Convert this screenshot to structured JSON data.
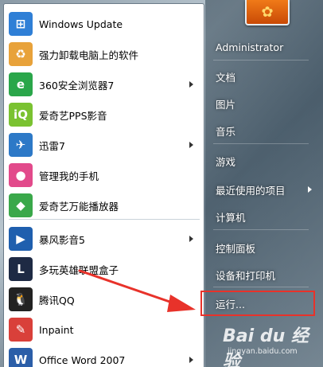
{
  "programs": [
    {
      "label": "Windows Update",
      "icon": "windows-update-icon",
      "color": "#2f7fd6",
      "glyph": "⊞",
      "has_submenu": false
    },
    {
      "label": "强力卸载电脑上的软件",
      "icon": "uninstall-icon",
      "color": "#e8a23a",
      "glyph": "♻",
      "has_submenu": false
    },
    {
      "label": "360安全浏览器7",
      "icon": "browser-360-icon",
      "color": "#2aa64a",
      "glyph": "e",
      "has_submenu": true
    },
    {
      "label": "爱奇艺PPS影音",
      "icon": "iqiyi-pps-icon",
      "color": "#7ac231",
      "glyph": "iQ",
      "has_submenu": false
    },
    {
      "label": "迅雷7",
      "icon": "xunlei-icon",
      "color": "#2d79c7",
      "glyph": "✈",
      "has_submenu": true
    },
    {
      "label": "管理我的手机",
      "icon": "phone-manager-icon",
      "color": "#e24a8b",
      "glyph": "●",
      "has_submenu": false
    },
    {
      "label": "爱奇艺万能播放器",
      "icon": "iqiyi-player-icon",
      "color": "#3aa84a",
      "glyph": "◆",
      "has_submenu": false
    },
    {
      "label": "暴风影音5",
      "icon": "baofeng-icon",
      "color": "#1f5fae",
      "glyph": "▶",
      "has_submenu": true
    },
    {
      "label": "多玩英雄联盟盒子",
      "icon": "lol-box-icon",
      "color": "#1e2a44",
      "glyph": "L",
      "has_submenu": false
    },
    {
      "label": "腾讯QQ",
      "icon": "qq-penguin-icon",
      "color": "#222222",
      "glyph": "🐧",
      "has_submenu": false
    },
    {
      "label": "Inpaint",
      "icon": "inpaint-icon",
      "color": "#d9403a",
      "glyph": "✎",
      "has_submenu": false
    },
    {
      "label": "Office Word 2007",
      "icon": "word-icon",
      "color": "#2b5ea8",
      "glyph": "W",
      "has_submenu": true
    }
  ],
  "right_items": [
    {
      "label": "Administrator",
      "name": "administrator",
      "has_submenu": false
    },
    {
      "label": "文档",
      "name": "documents",
      "has_submenu": false
    },
    {
      "label": "图片",
      "name": "pictures",
      "has_submenu": false
    },
    {
      "label": "音乐",
      "name": "music",
      "has_submenu": false
    },
    {
      "label": "游戏",
      "name": "games",
      "has_submenu": false
    },
    {
      "label": "最近使用的项目",
      "name": "recent-items",
      "has_submenu": true
    },
    {
      "label": "计算机",
      "name": "computer",
      "has_submenu": false
    },
    {
      "label": "控制面板",
      "name": "control-panel",
      "has_submenu": false
    },
    {
      "label": "设备和打印机",
      "name": "devices-and-printers",
      "has_submenu": false
    },
    {
      "label": "运行...",
      "name": "run",
      "has_submenu": false
    }
  ],
  "colors": {
    "highlight": "#e8322a",
    "user_picture": "#e06a12"
  },
  "watermark": {
    "logo": "Bai du 经验",
    "url": "jingyan.baidu.com"
  }
}
